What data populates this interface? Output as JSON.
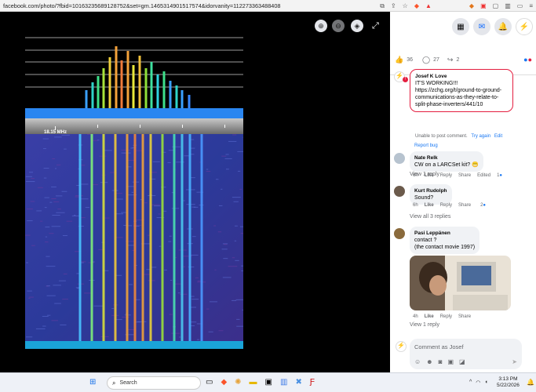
{
  "browser": {
    "url": "facebook.com/photo/?fbid=10163235689128752&set=gm.1465314901517574&idorvanity=112273363488408"
  },
  "viewer": {
    "spectrum_label": "18.15 MHz"
  },
  "post_stats": {
    "likes": "36",
    "comments": "27",
    "shares": "2"
  },
  "comments": [
    {
      "author": "Josef K Love",
      "text": "IT'S WORKING!!! https://zchg.org/t/ground-to-ground-communications-as-they-relate-to-split-phase-inverters/441/10",
      "error": "Unable to post comment.",
      "try_again": "Try again",
      "edit": "Edit",
      "report": "Report bug"
    },
    {
      "author": "Nate Relk",
      "text": "CW on a LARCSet kit?",
      "time": "6h",
      "like": "Like",
      "reply": "Reply",
      "share": "Share",
      "edited": "Edited",
      "reactions": "1",
      "view_replies": "View 1 reply"
    },
    {
      "author": "Kurt Rudolph",
      "text": "Sound?",
      "time": "6h",
      "like": "Like",
      "reply": "Reply",
      "share": "Share",
      "reactions": "2",
      "view_replies": "View all 3 replies"
    },
    {
      "author": "Pasi Leppänen",
      "text_line1": "contact ?",
      "text_line2": "(the contact movie 1997)",
      "time": "4h",
      "like": "Like",
      "reply": "Reply",
      "share": "Share",
      "view_replies": "View 1 reply"
    }
  ],
  "composer": {
    "placeholder": "Comment as Josef"
  },
  "taskbar": {
    "search": "Search",
    "time": "3:13 PM",
    "date": "5/22/2026"
  },
  "colors": {
    "fb_blue": "#1877f2",
    "error_red": "#e41e3f"
  }
}
